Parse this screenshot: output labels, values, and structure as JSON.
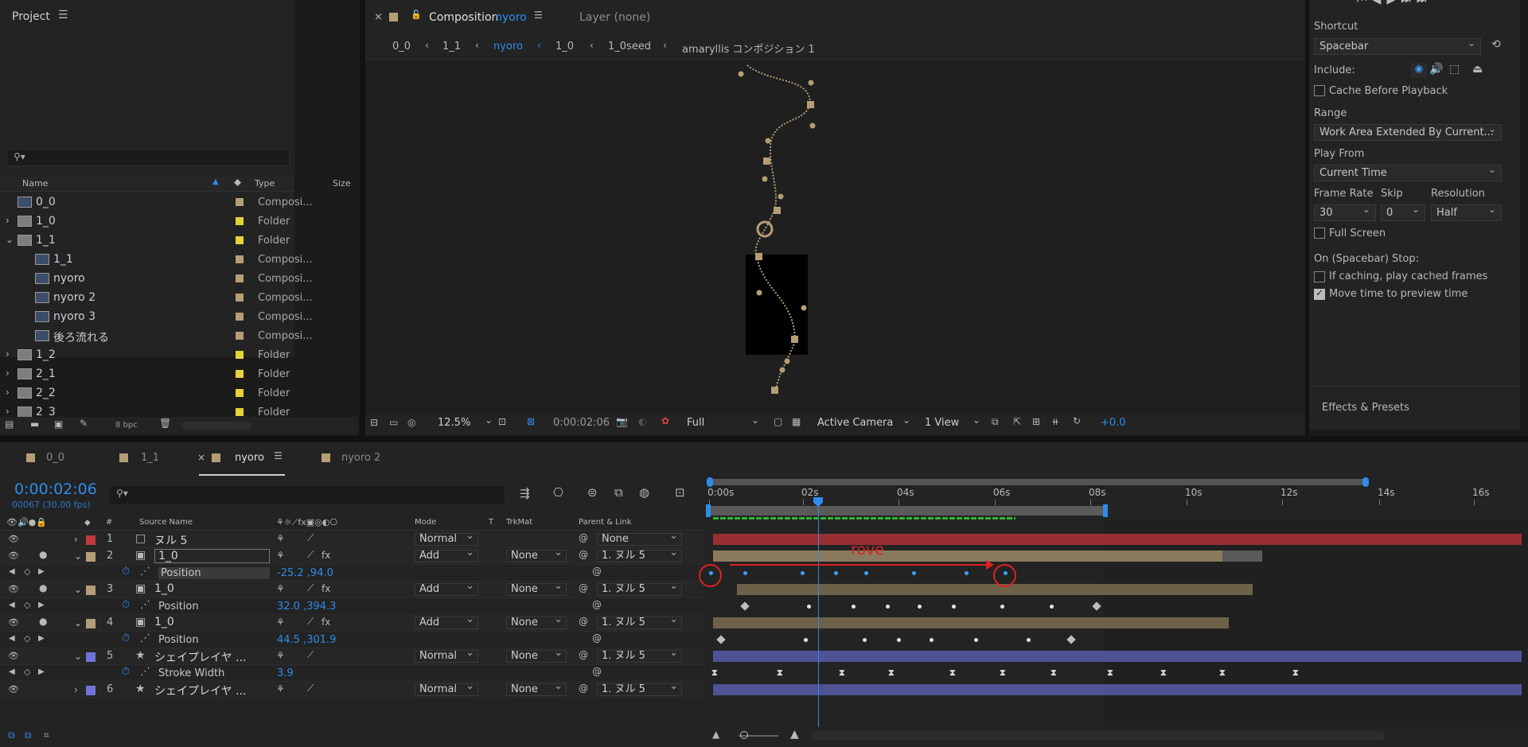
{
  "project": {
    "title": "Project",
    "search_placeholder": "",
    "col_name": "Name",
    "col_type": "Type",
    "col_size": "Size",
    "items": [
      {
        "name": "0_0",
        "type": "Composi...",
        "color": "#b59d76",
        "kind": "comp",
        "indent": 0,
        "twirl": ""
      },
      {
        "name": "1_0",
        "type": "Folder",
        "color": "#e8d23a",
        "kind": "folder",
        "indent": 0,
        "twirl": "›"
      },
      {
        "name": "1_1",
        "type": "Folder",
        "color": "#e8d23a",
        "kind": "folder",
        "indent": 0,
        "twirl": "⌄"
      },
      {
        "name": "1_1",
        "type": "Composi...",
        "color": "#b59d76",
        "kind": "comp",
        "indent": 1,
        "twirl": ""
      },
      {
        "name": "nyoro",
        "type": "Composi...",
        "color": "#b59d76",
        "kind": "comp",
        "indent": 1,
        "twirl": ""
      },
      {
        "name": "nyoro 2",
        "type": "Composi...",
        "color": "#b59d76",
        "kind": "comp",
        "indent": 1,
        "twirl": ""
      },
      {
        "name": "nyoro 3",
        "type": "Composi...",
        "color": "#b59d76",
        "kind": "comp",
        "indent": 1,
        "twirl": ""
      },
      {
        "name": "後ろ流れる",
        "type": "Composi...",
        "color": "#b59d76",
        "kind": "comp",
        "indent": 1,
        "twirl": ""
      },
      {
        "name": "1_2",
        "type": "Folder",
        "color": "#e8d23a",
        "kind": "folder",
        "indent": 0,
        "twirl": "›"
      },
      {
        "name": "2_1",
        "type": "Folder",
        "color": "#e8d23a",
        "kind": "folder",
        "indent": 0,
        "twirl": "›"
      },
      {
        "name": "2_2",
        "type": "Folder",
        "color": "#e8d23a",
        "kind": "folder",
        "indent": 0,
        "twirl": "›"
      },
      {
        "name": "2_3",
        "type": "Folder",
        "color": "#e8d23a",
        "kind": "folder",
        "indent": 0,
        "twirl": "›"
      }
    ],
    "bpc": "8 bpc"
  },
  "comp": {
    "tab_label": "Composition",
    "tab_name": "nyoro",
    "layer_tab": "Layer (none)",
    "breadcrumbs": [
      "0_0",
      "1_1",
      "nyoro",
      "1_0",
      "1_0seed",
      "amaryllis コンポジション 1"
    ],
    "zoom": "12.5%",
    "timecode": "0:00:02:06",
    "resolution": "Full",
    "camera": "Active Camera",
    "views": "1 View",
    "exposure": "+0.0"
  },
  "preview": {
    "shortcut_label": "Shortcut",
    "shortcut_value": "Spacebar",
    "include_label": "Include:",
    "cache_before": "Cache Before Playback",
    "range_label": "Range",
    "range_value": "Work Area Extended By Current...",
    "play_from_label": "Play From",
    "play_from_value": "Current Time",
    "frame_rate_label": "Frame Rate",
    "skip_label": "Skip",
    "resolution_label": "Resolution",
    "frame_rate_value": "30",
    "skip_value": "0",
    "resolution_value": "Half",
    "full_screen": "Full Screen",
    "stop_label": "On (Spacebar) Stop:",
    "if_caching": "If caching, play cached frames",
    "move_time": "Move time to preview time",
    "effects_presets": "Effects & Presets"
  },
  "timeline": {
    "tabs": [
      "0_0",
      "1_1",
      "nyoro",
      "nyoro 2"
    ],
    "active_tab": "nyoro",
    "current_time": "0:00:02:06",
    "frame_info": "00067 (30.00 fps)",
    "col_source": "Source Name",
    "col_mode": "Mode",
    "col_t": "T",
    "col_trkmat": "TrkMat",
    "col_parent": "Parent & Link",
    "col_num": "#",
    "ruler": [
      "0:00s",
      "02s",
      "04s",
      "06s",
      "08s",
      "10s",
      "12s",
      "14s",
      "16s"
    ],
    "annotation": "rove",
    "layers": [
      {
        "num": "1",
        "name": "ヌル 5",
        "mode": "Normal",
        "trkmat": "",
        "parent": "None",
        "label": "#c0393b",
        "icon": "null"
      },
      {
        "num": "2",
        "name": "1_0",
        "mode": "Add",
        "trkmat": "None",
        "parent": "1. ヌル 5",
        "label": "#b59d76",
        "icon": "comp"
      },
      {
        "prop": "Position",
        "value": "-25.2 ,94.0"
      },
      {
        "num": "3",
        "name": "1_0",
        "mode": "Add",
        "trkmat": "None",
        "parent": "1. ヌル 5",
        "label": "#b59d76",
        "icon": "comp"
      },
      {
        "prop": "Position",
        "value": "32.0 ,394.3"
      },
      {
        "num": "4",
        "name": "1_0",
        "mode": "Add",
        "trkmat": "None",
        "parent": "1. ヌル 5",
        "label": "#b59d76",
        "icon": "comp"
      },
      {
        "prop": "Position",
        "value": "44.5 ,301.9"
      },
      {
        "num": "5",
        "name": "シェイプレイヤ ...",
        "mode": "Normal",
        "trkmat": "None",
        "parent": "1. ヌル 5",
        "label": "#6f75d8",
        "icon": "star"
      },
      {
        "prop": "Stroke Width",
        "value": "3.9"
      },
      {
        "num": "6",
        "name": "シェイプレイヤ ...",
        "mode": "Normal",
        "trkmat": "None",
        "parent": "1. ヌル 5",
        "label": "#6f75d8",
        "icon": "star"
      }
    ]
  }
}
